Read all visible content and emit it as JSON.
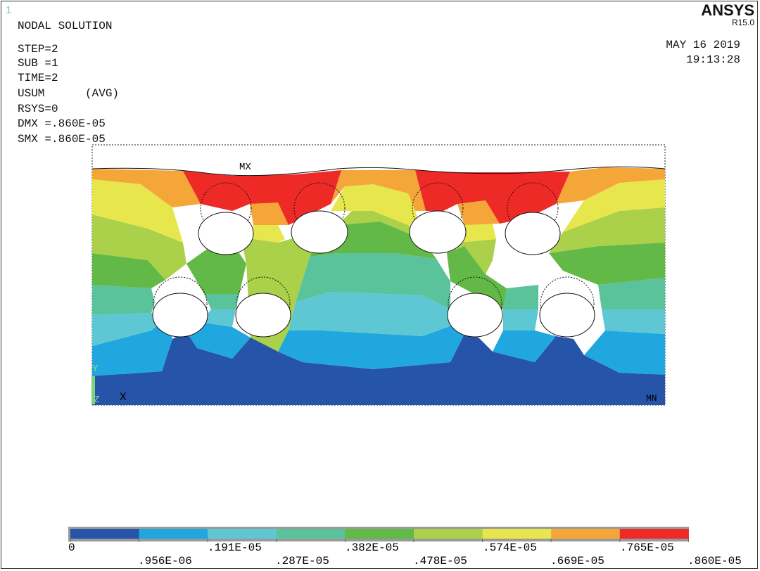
{
  "window_number": "1",
  "brand": {
    "name": "ANSYS",
    "release": "R15.0"
  },
  "header": {
    "title": "NODAL SOLUTION",
    "lines": [
      "STEP=2",
      "SUB =1",
      "TIME=2",
      "USUM      (AVG)",
      "RSYS=0",
      "DMX =.860E-05",
      "SMX =.860E-05"
    ]
  },
  "date": "MAY 16 2019",
  "time": "19:13:28",
  "plot_labels": {
    "max": "MX",
    "min": "MN",
    "axis_x": "X",
    "axis_y": "Y",
    "axis_z": "Z"
  },
  "colors": {
    "band0": "#2654a8",
    "band1": "#21a7e0",
    "band2": "#5dc8d3",
    "band3": "#5bc39c",
    "band4": "#63b947",
    "band5": "#abd04a",
    "band6": "#e8e64d",
    "band7": "#f4a738",
    "band8": "#ee2a27",
    "triad": "#7fd07f"
  },
  "legend": {
    "colors": [
      "#2654a8",
      "#21a7e0",
      "#5dc8d3",
      "#5bc39c",
      "#63b947",
      "#abd04a",
      "#e8e64d",
      "#f4a738",
      "#ee2a27"
    ],
    "labels_top": [
      "0",
      ".191E-05",
      ".382E-05",
      ".574E-05",
      ".765E-05"
    ],
    "labels_bottom": [
      ".956E-06",
      ".287E-05",
      ".478E-05",
      ".669E-05",
      ".860E-05"
    ]
  }
}
